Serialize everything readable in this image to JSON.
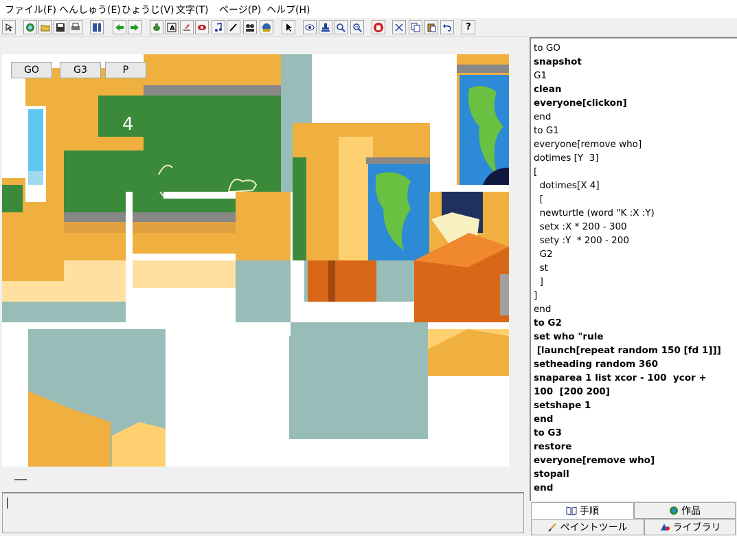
{
  "menu": [
    "ファイル(F)",
    "へんしゅう(E)",
    "ひょうじ(V)",
    "文字(T)",
    "ページ(P)",
    "ヘルプ(H)"
  ],
  "toolbar_icons": [
    "pointer-small-icon",
    "globe-icon",
    "open-folder-icon",
    "save-icon",
    "print-icon",
    "page-icon",
    "arrow-left-icon",
    "arrow-right-icon",
    "turtle-icon",
    "text-box-icon",
    "eraser-icon",
    "record-icon",
    "music-note-icon",
    "pen-icon",
    "group-icon",
    "scene-icon",
    "arrow-pointer-icon",
    "eye-icon",
    "stamp-icon",
    "zoom-in-icon",
    "zoom-out-icon",
    "hand-stop-icon",
    "cut-icon",
    "copy-icon",
    "paste-icon",
    "undo-icon",
    "help-icon"
  ],
  "help_label": "?",
  "buttons": {
    "go": "GO",
    "g3": "G3",
    "p": "P"
  },
  "code_lines": [
    {
      "text": "to GO",
      "bold": false
    },
    {
      "text": "snapshot",
      "bold": true
    },
    {
      "text": "G1",
      "bold": false
    },
    {
      "text": "clean",
      "bold": true
    },
    {
      "text": "everyone[clickon]",
      "bold": true
    },
    {
      "text": "end",
      "bold": false
    },
    {
      "text": "to G1",
      "bold": false
    },
    {
      "text": "everyone[remove who]",
      "bold": false
    },
    {
      "text": "dotimes [Y  3]",
      "bold": false
    },
    {
      "text": "[",
      "bold": false
    },
    {
      "text": "  dotimes[X 4]",
      "bold": false
    },
    {
      "text": "  [",
      "bold": false
    },
    {
      "text": "  newturtle (word \"K :X :Y)",
      "bold": false
    },
    {
      "text": "  setx :X * 200 - 300",
      "bold": false
    },
    {
      "text": "  sety :Y  * 200 - 200",
      "bold": false
    },
    {
      "text": "  G2",
      "bold": false
    },
    {
      "text": "  st",
      "bold": false
    },
    {
      "text": "  ]",
      "bold": false
    },
    {
      "text": "]",
      "bold": false
    },
    {
      "text": "end",
      "bold": false
    },
    {
      "text": "to G2",
      "bold": true
    },
    {
      "text": "set who \"rule",
      "bold": true
    },
    {
      "text": " [launch[repeat random 150 [fd 1]]]",
      "bold": true
    },
    {
      "text": "setheading random 360",
      "bold": true
    },
    {
      "text": "snaparea 1 list xcor - 100  ycor +",
      "bold": true
    },
    {
      "text": "100  [200 200]",
      "bold": true
    },
    {
      "text": "setshape 1",
      "bold": true
    },
    {
      "text": "end",
      "bold": true
    },
    {
      "text": "to G3",
      "bold": true
    },
    {
      "text": "restore",
      "bold": true
    },
    {
      "text": "everyone[remove who]",
      "bold": true
    },
    {
      "text": "stopall",
      "bold": true
    },
    {
      "text": "end",
      "bold": true
    }
  ],
  "tabs": {
    "procedures": "手順",
    "works": "作品",
    "paint_tool": "ペイントツール",
    "library": "ライブラリ"
  },
  "colors": {
    "wall_orange": "#f0b040",
    "floor_teal": "#98bcb8",
    "board_green": "#3a8a3a",
    "desk_orange": "#d86818",
    "globe_blue": "#2c8ad6",
    "land_green": "#6ac040"
  }
}
